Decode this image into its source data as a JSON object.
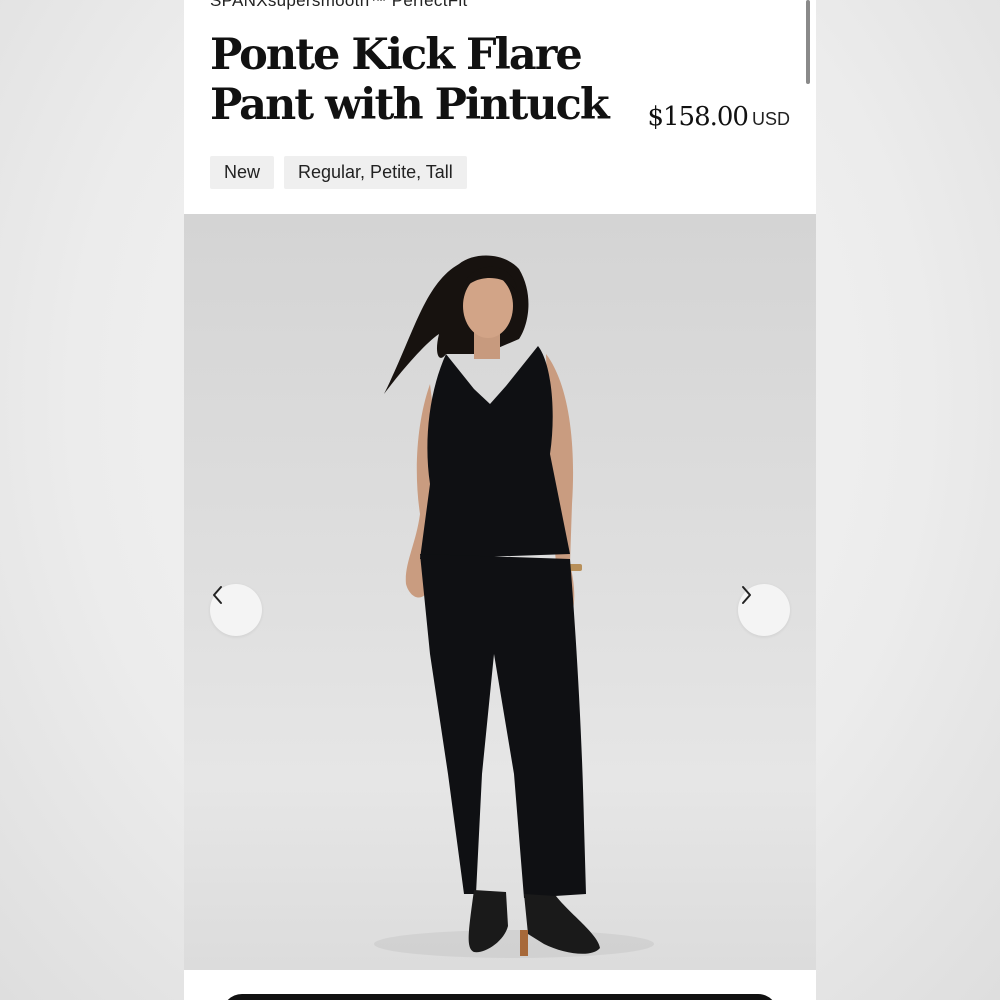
{
  "product": {
    "brand_line": "SPANXsupersmooth™ PerfectFit",
    "title": "Ponte Kick Flare Pant with Pintuck",
    "price": "$158.00",
    "currency": "USD",
    "tags": [
      "New",
      "Regular, Petite, Tall"
    ]
  },
  "gallery": {
    "prev_icon": "chevron-left-icon",
    "next_icon": "chevron-right-icon"
  },
  "colors": {
    "page_bg": "#ffffff",
    "outfit": "#0f1013",
    "tag_bg": "#efefef"
  }
}
